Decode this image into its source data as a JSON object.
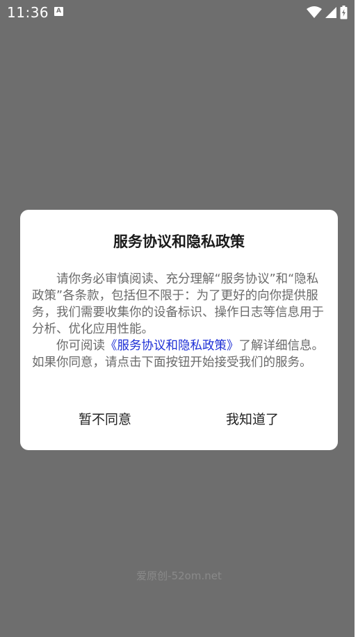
{
  "status_bar": {
    "time": "11:36",
    "notification_icon": "app-notification-icon",
    "icons": [
      "wifi-icon",
      "cell-signal-icon",
      "battery-charging-icon"
    ]
  },
  "dialog": {
    "title": "服务协议和隐私政策",
    "paragraph1": "请你务必审慎阅读、充分理解“服务协议”和“隐私政策”各条款，包括但不限于：为了更好的向你提供服务，我们需要收集你的设备标识、操作日志等信息用于分析、优化应用性能。",
    "paragraph2_prefix": "你可阅读",
    "policy_link": "《服务协议和隐私政策》",
    "paragraph2_suffix": "了解详细信息。如果你同意，请点击下面按钮开始接受我们的服务。",
    "decline_label": "暂不同意",
    "accept_label": "我知道了",
    "link_color": "#1e2fd6"
  },
  "watermark": "爱原创-52om.net"
}
